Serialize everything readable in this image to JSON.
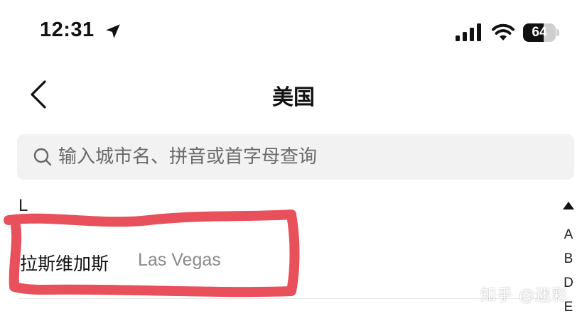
{
  "status_bar": {
    "time": "12:31",
    "battery_text": "64",
    "battery_level": 0.64,
    "icons": [
      "location-arrow-icon",
      "cellular-signal-icon",
      "wifi-icon",
      "battery-icon"
    ]
  },
  "nav": {
    "title": "美国",
    "back_icon": "chevron-left-icon"
  },
  "search": {
    "placeholder": "输入城市名、拼音或首字母查询",
    "value": "",
    "icon": "search-icon"
  },
  "section": {
    "letter": "L"
  },
  "cities": [
    {
      "name": "拉斯维加斯",
      "en": "Las Vegas"
    }
  ],
  "index": {
    "up_icon": "triangle-up-icon",
    "letters": [
      "A",
      "B",
      "D",
      "E"
    ]
  },
  "annotation": {
    "color": "#e8505b"
  },
  "watermark": "知乎 @迷彩"
}
